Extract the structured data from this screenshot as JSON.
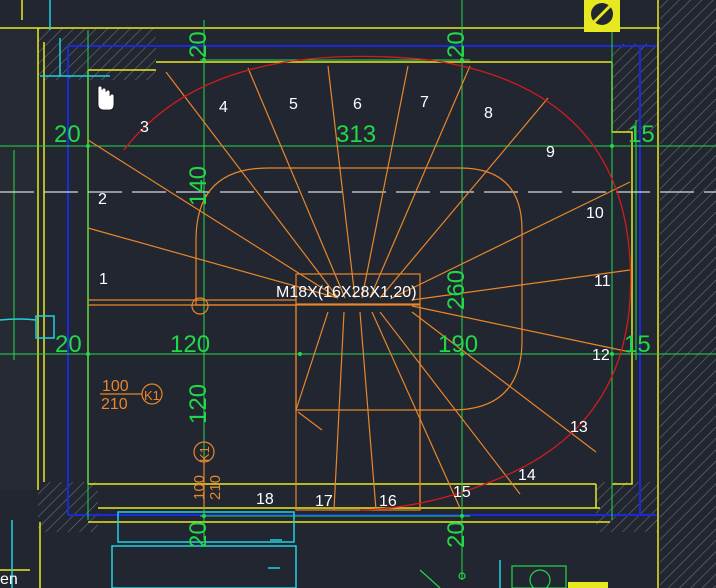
{
  "drawing": {
    "title_label": "M18X(16X28X1,20)",
    "step_numbers": [
      "1",
      "2",
      "3",
      "4",
      "5",
      "6",
      "7",
      "8",
      "9",
      "10",
      "11",
      "12",
      "13",
      "14",
      "15",
      "16",
      "17",
      "18"
    ],
    "dimensions": {
      "left_top": "20",
      "left_mid": "20",
      "center_mid_left": "120",
      "center_mid_right": "190",
      "top_span": "313",
      "right_top": "15",
      "right_mid": "15",
      "v_top_left": "20",
      "v_top_right": "20",
      "v_left_upper": "140",
      "v_right_center": "260",
      "v_left_lower": "120",
      "v_bottom_left": "20",
      "v_bottom_right": "20"
    },
    "door_left": {
      "top": "100",
      "bottom": "210",
      "tag": "K1"
    },
    "door_bottom": {
      "top": "100",
      "bottom": "210",
      "tag": "K1"
    },
    "edge_text": "en"
  },
  "colors": {
    "background": "#222630",
    "green": "#22d84a",
    "orange": "#e8862a",
    "red": "#d01c1c",
    "white": "#ffffff",
    "yellow": "#e8e820",
    "blue": "#1a2ad8",
    "cyan": "#20d0e0",
    "gray_hatch": "#6a6e74"
  },
  "icons": [
    "hand-cursor-icon",
    "lock-symbol-icon"
  ]
}
